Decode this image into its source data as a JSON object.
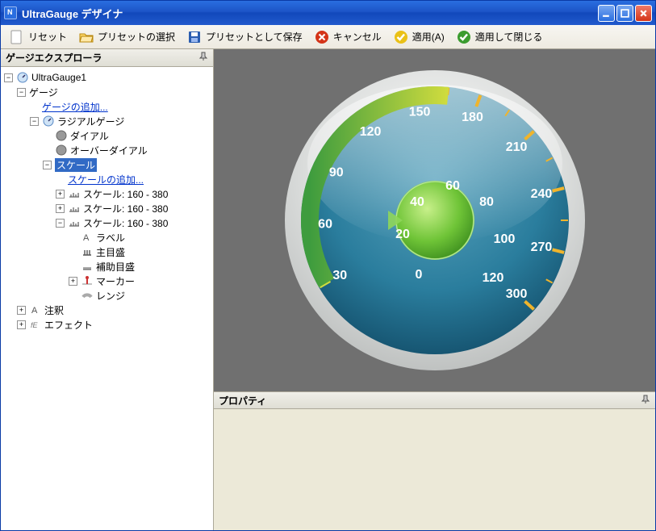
{
  "window": {
    "title": "UltraGauge デザイナ"
  },
  "toolbar": {
    "reset": "リセット",
    "select_preset": "プリセットの選択",
    "save_as_preset": "プリセットとして保存",
    "cancel": "キャンセル",
    "apply": "適用(A)",
    "apply_close": "適用して閉じる"
  },
  "explorer": {
    "title": "ゲージエクスプローラ",
    "root": "UltraGauge1",
    "nodes": {
      "gauges": "ゲージ",
      "add_gauge": "ゲージの追加...",
      "radial_gauge": "ラジアルゲージ",
      "dial": "ダイアル",
      "over_dial": "オーバーダイアル",
      "scales": "スケール",
      "add_scale": "スケールの追加...",
      "scale1": "スケール: 160 - 380",
      "scale2": "スケール: 160 - 380",
      "scale3": "スケール: 160 - 380",
      "label": "ラベル",
      "major_ticks": "主目盛",
      "minor_ticks": "補助目盛",
      "marker": "マーカー",
      "range": "レンジ",
      "annotation": "注釈",
      "effect": "エフェクト"
    }
  },
  "props": {
    "title": "プロパティ"
  },
  "gauge": {
    "outer_ticks": [
      {
        "v": "30",
        "a": 210
      },
      {
        "v": "60",
        "a": 182
      },
      {
        "v": "90",
        "a": 154
      },
      {
        "v": "120",
        "a": 126
      },
      {
        "v": "150",
        "a": 98
      },
      {
        "v": "180",
        "a": 70
      },
      {
        "v": "210",
        "a": 42
      },
      {
        "v": "240",
        "a": 14
      },
      {
        "v": "270",
        "a": -14
      },
      {
        "v": "300",
        "a": -42
      }
    ],
    "inner_scale": [
      "0",
      "20",
      "40",
      "60",
      "80",
      "100",
      "120"
    ]
  }
}
